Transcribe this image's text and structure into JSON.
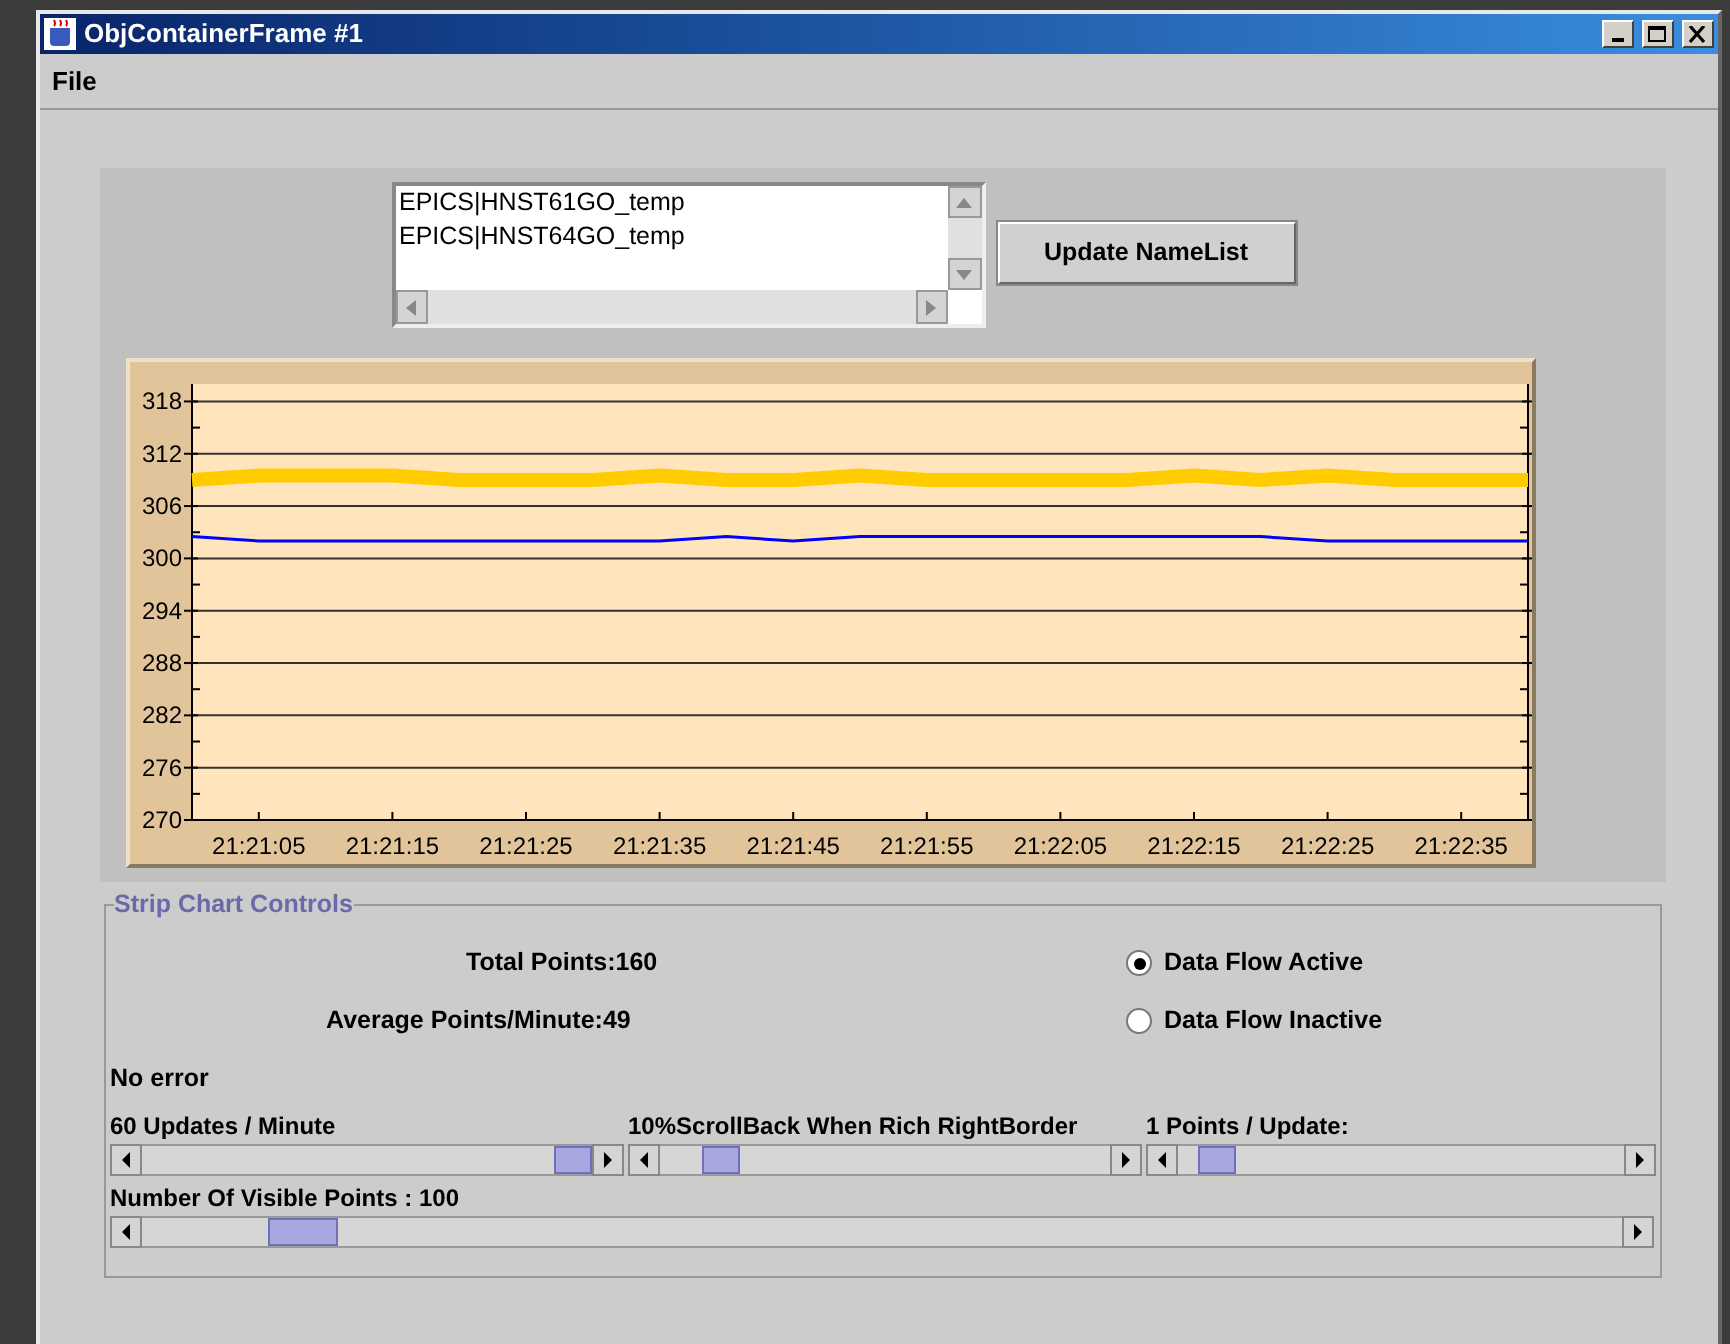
{
  "window": {
    "title": "ObjContainerFrame #1"
  },
  "menu": [
    {
      "label": "File"
    }
  ],
  "name_list": {
    "items": [
      "EPICS|HNST61GO_temp",
      "EPICS|HNST64GO_temp"
    ],
    "button": "Update NameList"
  },
  "chart": {
    "chart_data": {
      "type": "line",
      "categories": [
        null,
        "21:21:05",
        null,
        "21:21:15",
        null,
        "21:21:25",
        null,
        "21:21:35",
        null,
        "21:21:45",
        null,
        "21:21:55",
        null,
        "21:22:05",
        null,
        "21:22:15",
        null,
        "21:22:25",
        null,
        "21:22:35",
        null
      ],
      "series": [
        {
          "color": "#ffcc00",
          "values": [
            309,
            309.5,
            309.5,
            309.5,
            309,
            309,
            309,
            309.5,
            309,
            309,
            309.5,
            309,
            309,
            309,
            309,
            309.5,
            309,
            309.5,
            309,
            309,
            309
          ]
        },
        {
          "color": "#0000ff",
          "values": [
            302.5,
            302,
            302,
            302,
            302,
            302,
            302,
            302,
            302.5,
            302,
            302.5,
            302.5,
            302.5,
            302.5,
            302.5,
            302.5,
            302.5,
            302,
            302,
            302,
            302
          ]
        }
      ],
      "ylim": [
        270,
        320
      ],
      "grid": true,
      "yticks": [
        270,
        276,
        282,
        288,
        294,
        300,
        306,
        312,
        318
      ]
    }
  },
  "controls": {
    "title": "Strip Chart Controls",
    "total_points": "Total Points:160",
    "average": "Average Points/Minute:49",
    "radios": [
      {
        "label": "Data Flow Active",
        "selected": true
      },
      {
        "label": "Data Flow Inactive",
        "selected": false
      }
    ],
    "status": "No error",
    "sliders": [
      {
        "label": "60 Updates / Minute",
        "level": 1.0
      },
      {
        "label": "10%ScrollBack When Rich RightBorder",
        "level": 0.1
      },
      {
        "label": "1 Points / Update:",
        "level": 0.05
      }
    ],
    "visible_points": {
      "label": "Number Of Visible Points : 100",
      "level": 0.09
    }
  }
}
